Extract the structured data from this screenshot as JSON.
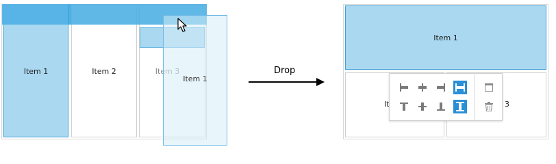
{
  "before": {
    "items": [
      {
        "label": "Item 1"
      },
      {
        "label": "Item 2"
      },
      {
        "label": "Item 3"
      }
    ],
    "dragged_item": {
      "label": "Item 1"
    }
  },
  "transition": {
    "label": "Drop"
  },
  "after": {
    "top_item": {
      "label": "Item 1"
    },
    "bottom_left_label": "It",
    "bottom_right_label": "3"
  },
  "toolbar": {
    "buttons": [
      {
        "icon": "align-left-icon",
        "active": false
      },
      {
        "icon": "align-center-horizontal-icon",
        "active": false
      },
      {
        "icon": "align-right-icon",
        "active": false
      },
      {
        "icon": "stretch-horizontal-icon",
        "active": true
      },
      {
        "icon": "align-top-icon",
        "active": false
      },
      {
        "icon": "align-middle-vertical-icon",
        "active": false
      },
      {
        "icon": "align-bottom-icon",
        "active": false
      },
      {
        "icon": "stretch-vertical-icon",
        "active": true
      },
      {
        "icon": "maximize-window-icon",
        "active": false
      },
      {
        "icon": "trash-icon",
        "active": false
      }
    ]
  },
  "colors": {
    "accent": "#2a8fd6",
    "selected_fill": "#a9d8f0",
    "drop_bar": "#4fb0e4"
  }
}
